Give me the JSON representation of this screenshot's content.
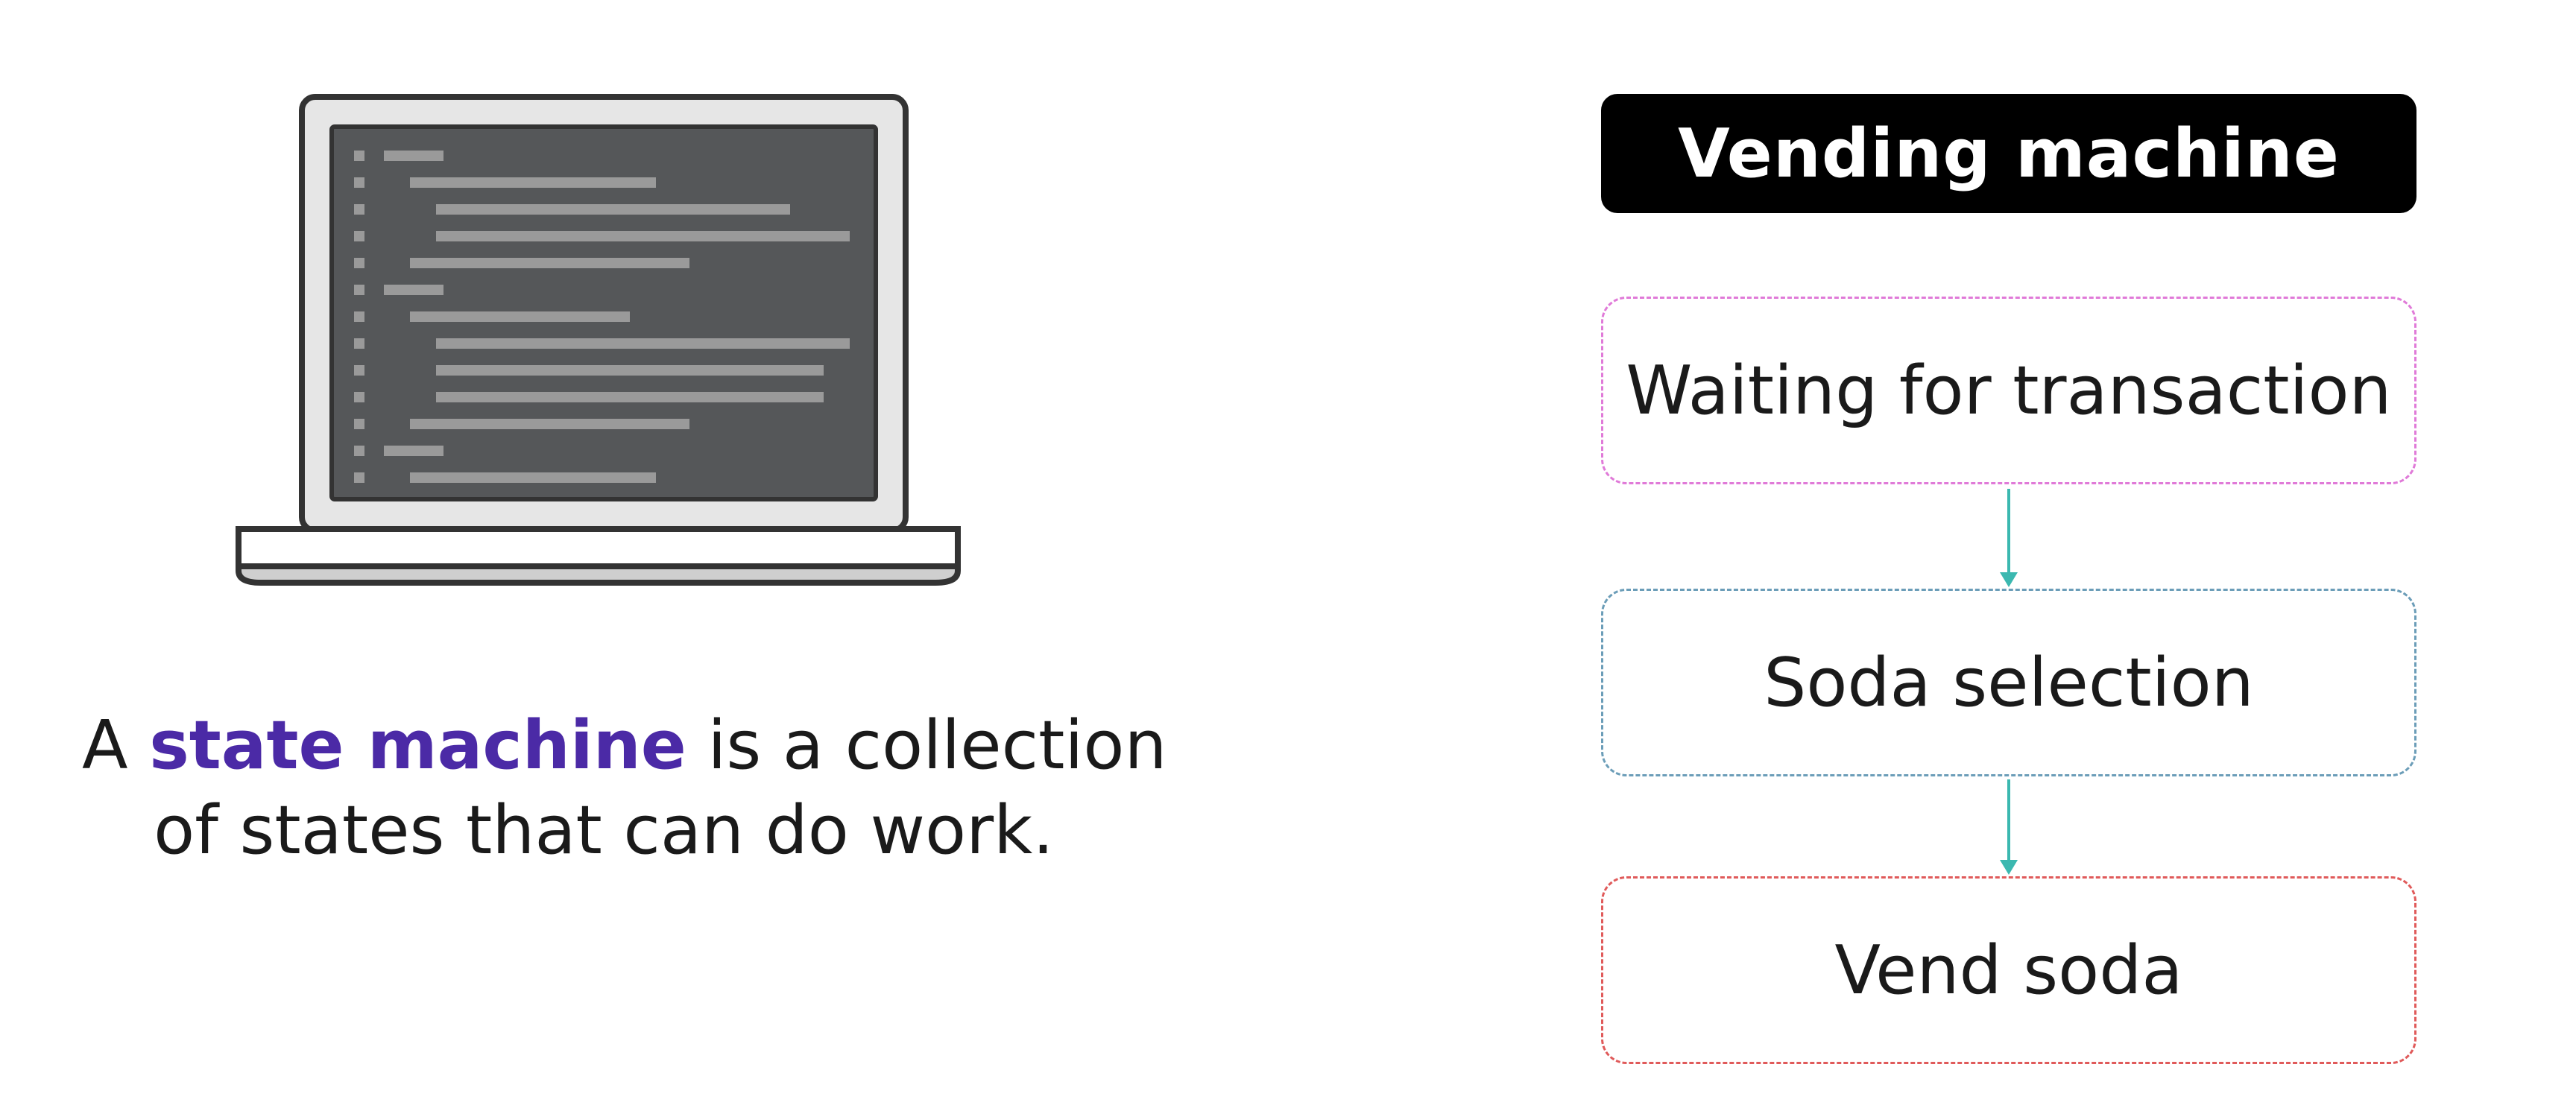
{
  "caption": {
    "prefix": "A ",
    "highlight": "state machine",
    "suffix": " is a collection",
    "line2": "of states that can do work."
  },
  "diagram": {
    "title": "Vending machine",
    "states": [
      {
        "label": "Waiting for transaction",
        "border_color": "#e07ad8"
      },
      {
        "label": "Soda selection",
        "border_color": "#6b9db8"
      },
      {
        "label": "Vend soda",
        "border_color": "#e05a5a"
      }
    ],
    "arrow_color": "#3bb8b0"
  },
  "illustration": {
    "icon": "laptop-code-icon"
  }
}
